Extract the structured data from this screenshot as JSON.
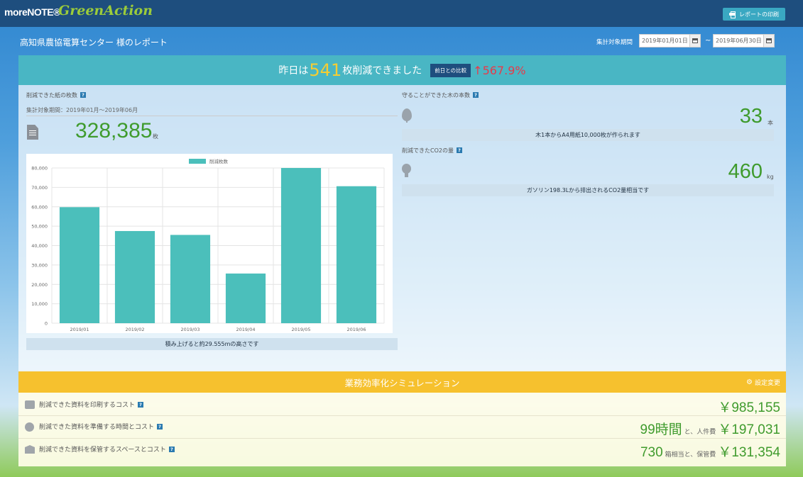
{
  "topbar": {
    "logo_more": "moreNOTE®",
    "logo_green": "GreenAction",
    "print_label": "レポートの印刷"
  },
  "header": {
    "report_title": "高知県農協電算センター 様のレポート",
    "period_label": "集計対象期間",
    "date_from": "2019年01月01日",
    "date_to": "2019年06月30日",
    "tilde": "~"
  },
  "banner": {
    "prefix": "昨日は",
    "number": "541",
    "suffix": "枚削減できました",
    "compare_label": "前日との比較",
    "compare_arrow": "↑",
    "compare_value": "567.9%"
  },
  "paper": {
    "label": "削減できた紙の枚数",
    "help": "?",
    "subperiod": "集計対象期間：2019年01月～2019年06月",
    "value": "328,385",
    "unit": "枚",
    "height_note": "積み上げると約29.555mの高さです"
  },
  "trees": {
    "label": "守ることができた木の本数",
    "help": "?",
    "value": "33",
    "unit": "本",
    "note": "木1本からA4用紙10,000枚が作られます"
  },
  "co2": {
    "label": "削減できたCO2の量",
    "help": "?",
    "value": "460",
    "unit": "kg",
    "note": "ガソリン198.3Lから排出されるCO2量相当です"
  },
  "chart_data": {
    "type": "bar",
    "categories": [
      "2019/01",
      "2019/02",
      "2019/03",
      "2019/04",
      "2019/05",
      "2019/06"
    ],
    "series": [
      {
        "name": "削減枚数",
        "values": [
          59800,
          47500,
          45500,
          25600,
          80000,
          70600
        ],
        "color": "#4bbfbb"
      }
    ],
    "ylim": [
      0,
      80000
    ],
    "yticks": [
      "0",
      "10,000",
      "20,000",
      "30,000",
      "40,000",
      "50,000",
      "60,000",
      "70,000",
      "80,000"
    ],
    "grid": true,
    "legend": "top-center"
  },
  "simulation": {
    "title": "業務効率化シミュレーション",
    "settings_label": "設定変更",
    "rows": [
      {
        "label": "削減できた資料を印刷するコスト",
        "help": "?",
        "value": "￥985,155"
      },
      {
        "label": "削減できた資料を準備する時間とコスト",
        "help": "?",
        "value_a": "99時間",
        "mid": "と、人件費",
        "value_b": "￥197,031"
      },
      {
        "label": "削減できた資料を保管するスペースとコスト",
        "help": "?",
        "value_a": "730",
        "mid": "箱相当と、保管費",
        "value_b": "￥131,354"
      }
    ]
  }
}
